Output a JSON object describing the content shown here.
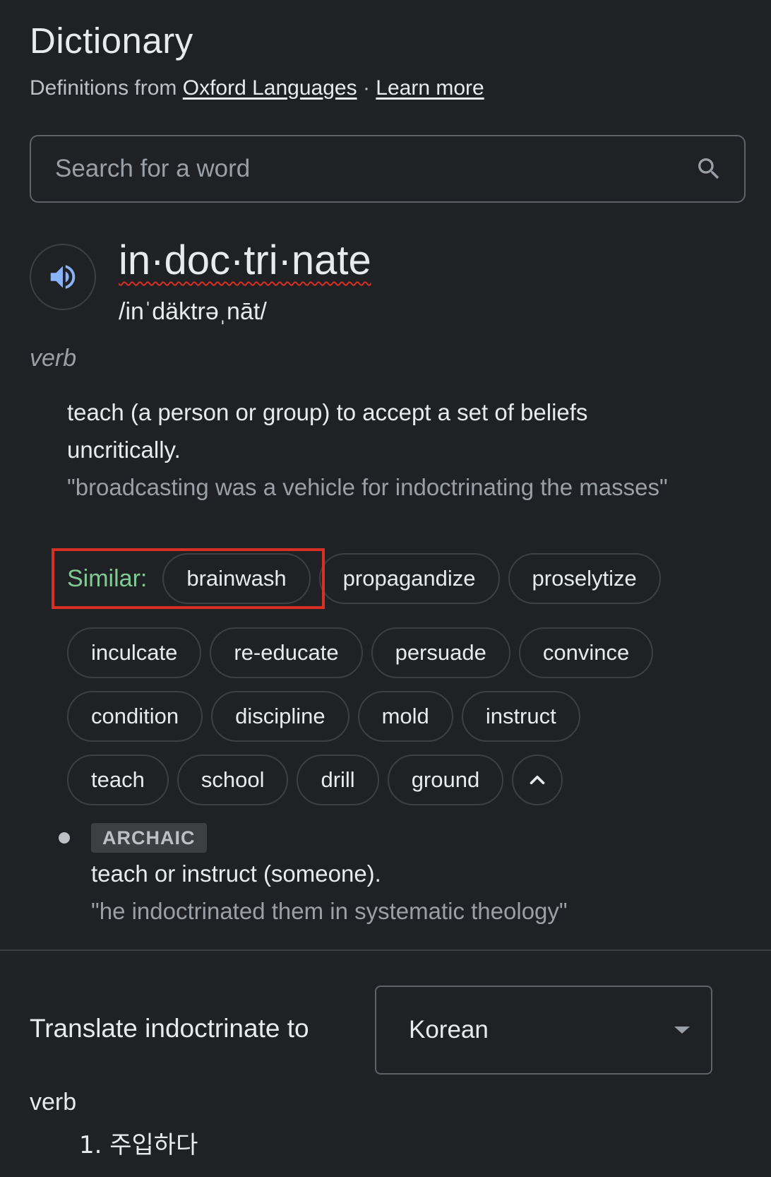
{
  "header": {
    "title": "Dictionary",
    "source_prefix": "Definitions from",
    "source_link": "Oxford Languages",
    "separator": "·",
    "learn_more": "Learn more"
  },
  "search": {
    "placeholder": "Search for a word",
    "icon": "search-icon"
  },
  "entry": {
    "audio_icon": "speaker-icon",
    "headword": "in·doc·tri·nate",
    "pronunciation": "/inˈdäktrəˌnāt/",
    "part_of_speech": "verb",
    "definition": "teach (a person or group) to accept a set of beliefs uncritically.",
    "example": "\"broadcasting was a vehicle for indoctrinating the masses\"",
    "similar_label": "Similar:",
    "similar_row1": [
      "brainwash",
      "propagandize",
      "proselytize"
    ],
    "similar_row2": [
      "inculcate",
      "re-educate",
      "persuade",
      "convince"
    ],
    "similar_row3": [
      "condition",
      "discipline",
      "mold",
      "instruct"
    ],
    "similar_row4": [
      "teach",
      "school",
      "drill",
      "ground"
    ],
    "collapse_icon": "chevron-up-icon",
    "sense2": {
      "label": "ARCHAIC",
      "definition": "teach or instruct (someone).",
      "example": "\"he indoctrinated them in systematic theology\""
    }
  },
  "translate": {
    "label": "Translate indoctrinate to",
    "language": "Korean",
    "part_of_speech": "verb",
    "items": [
      "1. 주입하다"
    ]
  },
  "colors": {
    "background": "#202124",
    "similar_label": "#81c995",
    "highlight": "#d93025"
  }
}
